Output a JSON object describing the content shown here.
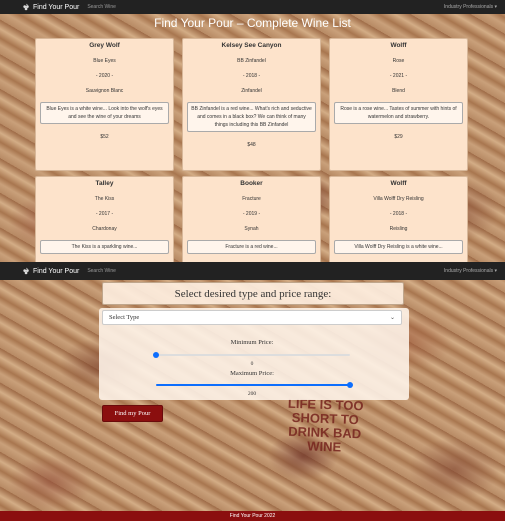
{
  "nav": {
    "brand": "Find Your Pour",
    "search_link": "Search Wine",
    "industry_dropdown": "Industry Professionals ▾"
  },
  "list": {
    "title": "Find Your Pour – Complete Wine List",
    "cards": [
      {
        "name": "Grey Wolf",
        "wine": "Blue Eyes",
        "year": "- 2020 -",
        "varietal": "Sauvignon Blanc",
        "desc": "Blue Eyes is a white wine... Look into the wolf's eyes and see the wine of your dreams",
        "price": "$52"
      },
      {
        "name": "Kelsey See Canyon",
        "wine": "BB Zinfandel",
        "year": "- 2018 -",
        "varietal": "Zinfandel",
        "desc": "BB Zinfandel is a red wine... What's rich and seductive and comes in a black box? We can think of many things including this BB Zinfandel",
        "price": "$48"
      },
      {
        "name": "Wolff",
        "wine": "Rose",
        "year": "- 2021 -",
        "varietal": "Blend",
        "desc": "Rose is a rose wine... Tastes of summer with hints of watermelon and strawberry.",
        "price": "$29"
      },
      {
        "name": "Talley",
        "wine": "The Kiss",
        "year": "- 2017 -",
        "varietal": "Chardonay",
        "desc": "The Kiss is a sparkling wine...",
        "price": ""
      },
      {
        "name": "Booker",
        "wine": "Fracture",
        "year": "- 2019 -",
        "varietal": "Synah",
        "desc": "Fracture is a red wine...",
        "price": ""
      },
      {
        "name": "Wolff",
        "wine": "Villa Wolff Dry Reisling",
        "year": "- 2018 -",
        "varietal": "Reisling",
        "desc": "Villa Wolff Dry Reisling is a white wine...",
        "price": ""
      }
    ]
  },
  "form": {
    "title": "Select desired type and price range:",
    "select_value": "Select Type",
    "min_label": "Minimum Price:",
    "min_value": "0",
    "min_fraction": 0.0,
    "max_label": "Maximum Price:",
    "max_value": "200",
    "max_fraction": 1.0,
    "submit_label": "Find my Pour"
  },
  "cork_text": "LIFE IS TOO SHORT TO DRINK BAD WINE",
  "footer": "Find Your Pour 2022",
  "colors": {
    "accent_red": "#8b0f0f",
    "slider_blue": "#0d6efd",
    "card_bg": "#fde3cb"
  },
  "icons": {
    "brand": "grapes-icon",
    "select": "chevron-down-icon"
  }
}
